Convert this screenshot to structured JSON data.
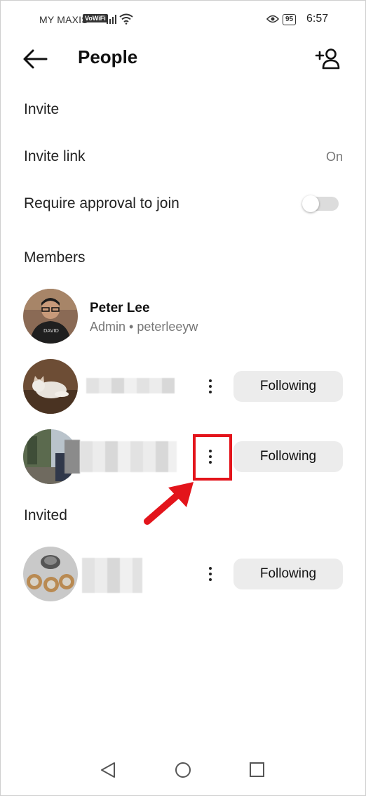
{
  "status_bar": {
    "carrier": "MY MAXIS",
    "vowifi": "VoWiFi",
    "battery": "95",
    "time": "6:57"
  },
  "header": {
    "title": "People",
    "back_icon": "arrow-left-icon",
    "add_icon": "add-person-icon"
  },
  "invite": {
    "section_title": "Invite",
    "invite_link_label": "Invite link",
    "invite_link_value": "On",
    "approval_label": "Require approval to join",
    "approval_enabled": false
  },
  "members": {
    "section_title": "Members",
    "admin": {
      "name": "Peter Lee",
      "subtitle": "Admin • peterleeyw"
    },
    "list": [
      {
        "name": "",
        "button": "Following"
      },
      {
        "name": "",
        "button": "Following"
      }
    ]
  },
  "invited": {
    "section_title": "Invited",
    "list": [
      {
        "name": "",
        "button": "Following"
      }
    ]
  },
  "colors": {
    "highlight": "#e3141b",
    "button_bg": "#ececec",
    "secondary_text": "#777777"
  }
}
